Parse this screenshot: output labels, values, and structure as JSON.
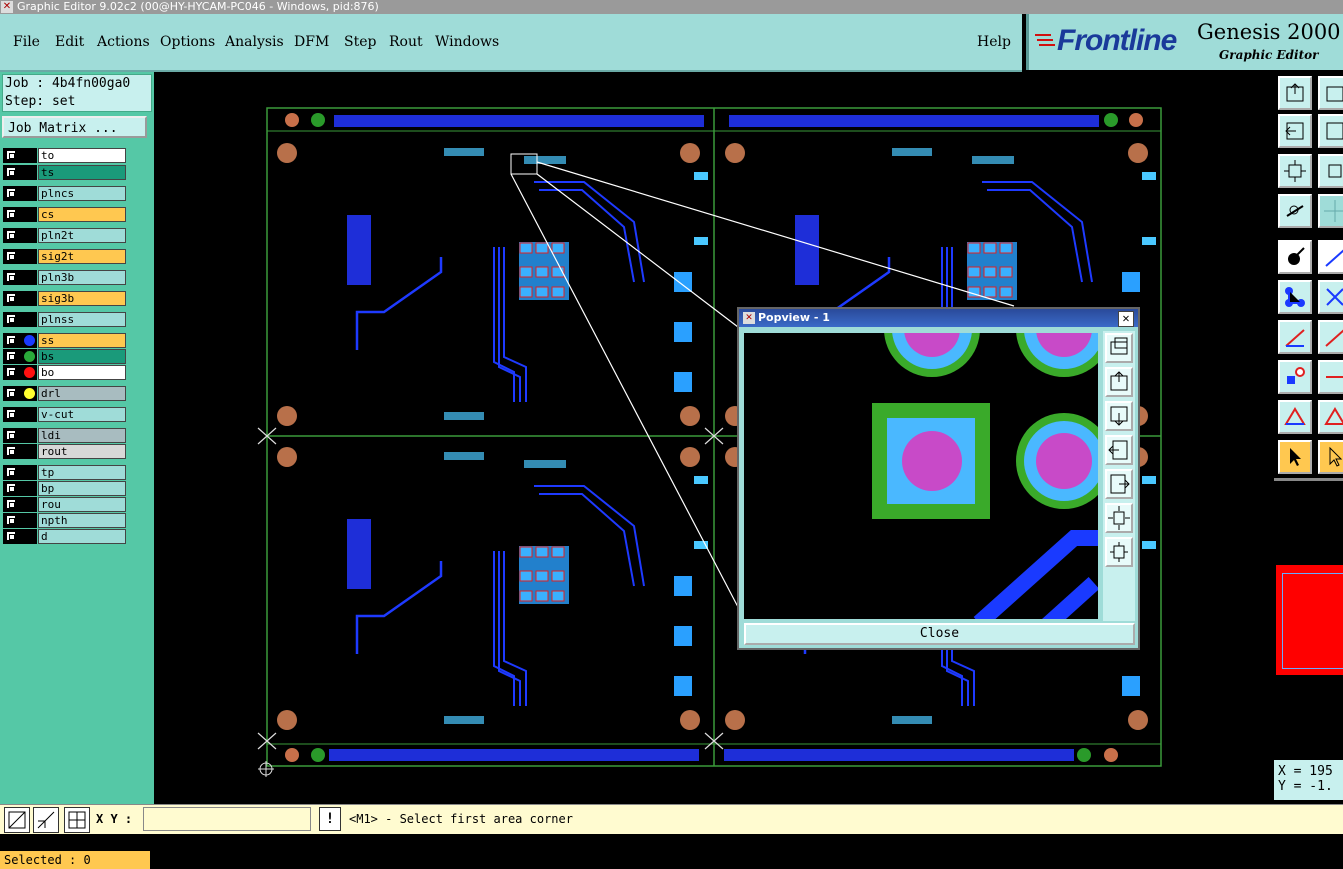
{
  "window": {
    "title": "Graphic Editor 9.02c2 (00@HY-HYCAM-PC046 - Windows, pid:876)"
  },
  "menu": {
    "items": [
      "File",
      "Edit",
      "Actions",
      "Options",
      "Analysis",
      "DFM",
      "Step",
      "Rout",
      "Windows"
    ],
    "help": "Help"
  },
  "brand": {
    "logo": "Frontline",
    "product": "Genesis 2000",
    "sub": "Graphic Editor"
  },
  "job": {
    "job_line": "Job : 4b4fn00ga0",
    "step_line": "Step: set",
    "matrix_button": "Job Matrix ..."
  },
  "layers": [
    {
      "name": "to",
      "color": "#ffffff",
      "dot": ""
    },
    {
      "name": "ts",
      "color": "#1a9a7a",
      "dot": ""
    },
    {
      "name": "plncs",
      "color": "#9fdcd8",
      "dot": ""
    },
    {
      "name": "cs",
      "color": "#ffc850",
      "dot": ""
    },
    {
      "name": "pln2t",
      "color": "#9fdcd8",
      "dot": ""
    },
    {
      "name": "sig2t",
      "color": "#ffc850",
      "dot": ""
    },
    {
      "name": "pln3b",
      "color": "#9fdcd8",
      "dot": ""
    },
    {
      "name": "sig3b",
      "color": "#ffc850",
      "dot": ""
    },
    {
      "name": "plnss",
      "color": "#9fdcd8",
      "dot": ""
    },
    {
      "name": "ss",
      "color": "#ffc850",
      "dot": "#1a3aff"
    },
    {
      "name": "bs",
      "color": "#1a9a7a",
      "dot": "#2aaa3a"
    },
    {
      "name": "bo",
      "color": "#ffffff",
      "dot": "#ff1010"
    },
    {
      "name": "drl",
      "color": "#a8bcc0",
      "dot": "#ffff30"
    },
    {
      "name": "v-cut",
      "color": "#9fdcd8",
      "dot": ""
    },
    {
      "name": "ldi",
      "color": "#a8bcc0",
      "dot": ""
    },
    {
      "name": "rout",
      "color": "#d8d8d8",
      "dot": ""
    },
    {
      "name": "tp",
      "color": "#9fdcd8",
      "dot": ""
    },
    {
      "name": "bp",
      "color": "#9fdcd8",
      "dot": ""
    },
    {
      "name": "rou",
      "color": "#9fdcd8",
      "dot": ""
    },
    {
      "name": "npth",
      "color": "#9fdcd8",
      "dot": ""
    },
    {
      "name": "d",
      "color": "#9fdcd8",
      "dot": ""
    }
  ],
  "selected": "Selected : 0",
  "popview": {
    "title": "Popview - 1",
    "close_label": "Close"
  },
  "coords": {
    "x": "X = 195",
    "y": "Y = -1."
  },
  "bottom": {
    "xy_label": "X Y :",
    "xy_value": "",
    "warn": "!",
    "status": "<M1> - Select first area corner"
  }
}
